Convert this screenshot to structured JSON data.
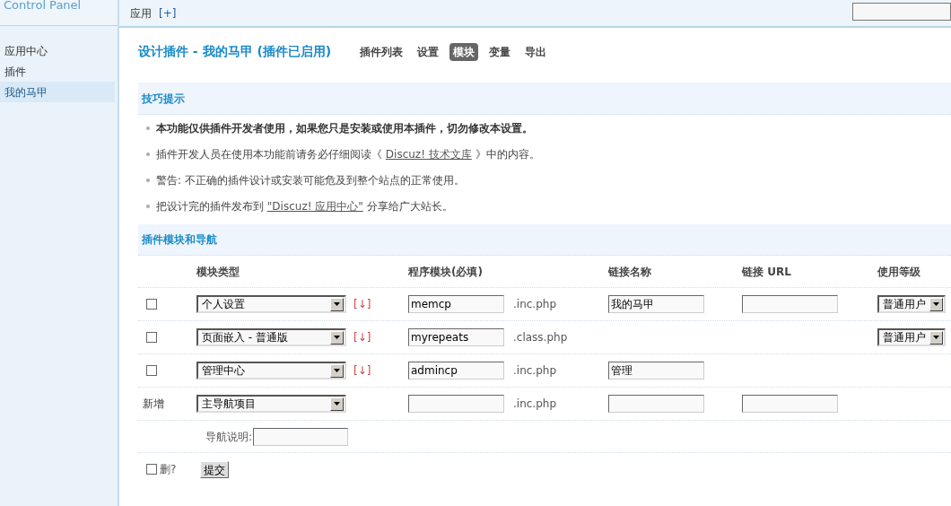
{
  "logo": "Control Panel",
  "header": {
    "tab": "应用",
    "add": "[+]"
  },
  "sidebar": {
    "items": [
      {
        "label": "应用中心",
        "selected": false
      },
      {
        "label": "插件",
        "selected": false
      },
      {
        "label": "我的马甲",
        "selected": true
      }
    ]
  },
  "title": "设计插件 - 我的马甲 (插件已启用)",
  "tabs": [
    {
      "label": "插件列表",
      "selected": false
    },
    {
      "label": "设置",
      "selected": false
    },
    {
      "label": "模块",
      "selected": true
    },
    {
      "label": "变量",
      "selected": false
    },
    {
      "label": "导出",
      "selected": false
    }
  ],
  "tips": {
    "heading": "技巧提示",
    "items": [
      {
        "kind": "bold",
        "text": "本功能仅供插件开发者使用，如果您只是安装或使用本插件，切勿修改本设置。"
      },
      {
        "kind": "link",
        "before": "插件开发人员在使用本功能前请务必仔细阅读《 ",
        "link": "Discuz! 技术文库",
        "after": " 》中的内容。"
      },
      {
        "kind": "plain",
        "text": "警告: 不正确的插件设计或安装可能危及到整个站点的正常使用。"
      },
      {
        "kind": "link",
        "before": "把设计完的插件发布到 ",
        "link": "\"Discuz! 应用中心\"",
        "after": " 分享给广大站长。"
      }
    ]
  },
  "modules": {
    "heading": "插件模块和导航",
    "columns": [
      "模块类型",
      "程序模块(必填)",
      "链接名称",
      "链接 URL",
      "使用等级"
    ],
    "rows": [
      {
        "kind": "checkbox",
        "checked": false,
        "type": "个人设置",
        "move": "[↓]",
        "module": "memcp",
        "suffix": ".inc.php",
        "link_name": "我的马甲",
        "url_field": true,
        "level_select": "普通用户"
      },
      {
        "kind": "checkbox",
        "checked": false,
        "type": "页面嵌入 - 普通版",
        "move": "[↓]",
        "module": "myrepeats",
        "suffix": ".class.php",
        "level_select": "普通用户"
      },
      {
        "kind": "checkbox",
        "checked": false,
        "type": "管理中心",
        "move": "[↓]",
        "module": "admincp",
        "suffix": ".inc.php",
        "link_name": "管理"
      },
      {
        "kind": "new",
        "label": "新增",
        "type": "主导航项目",
        "suffix": ".inc.php",
        "link_name": "",
        "url_field": true
      }
    ],
    "nav_desc_label": "导航说明:",
    "delete": {
      "checked": false,
      "label": "删?"
    },
    "submit": "提交"
  }
}
